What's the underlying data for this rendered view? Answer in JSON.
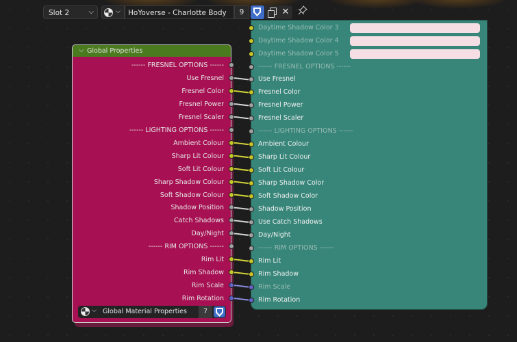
{
  "header": {
    "slot_label": "Slot 2",
    "material_name": "HoYoverse - Charlotte Body",
    "user_count": "9"
  },
  "group_node": {
    "title": "Global Properties",
    "sockets": [
      {
        "label": "------ FRESNEL OPTIONS ------",
        "type": "gray"
      },
      {
        "label": "Use Fresnel",
        "type": "gray"
      },
      {
        "label": "Fresnel Color",
        "type": "yellow"
      },
      {
        "label": "Fresnel Power",
        "type": "gray"
      },
      {
        "label": "Fresnel Scaler",
        "type": "gray"
      },
      {
        "label": "------ LIGHTING OPTIONS ------",
        "type": "gray"
      },
      {
        "label": "Ambient Colour",
        "type": "yellow"
      },
      {
        "label": "Sharp Lit Colour",
        "type": "yellow"
      },
      {
        "label": "Soft Lit Colour",
        "type": "yellow"
      },
      {
        "label": "Sharp Shadow Colour",
        "type": "yellow"
      },
      {
        "label": "Soft Shadow Colour",
        "type": "yellow"
      },
      {
        "label": "Shadow Position",
        "type": "gray"
      },
      {
        "label": "Catch Shadows",
        "type": "gray"
      },
      {
        "label": "Day/Night",
        "type": "gray"
      },
      {
        "label": "------ RIM OPTIONS ------",
        "type": "gray"
      },
      {
        "label": "Rim Lit",
        "type": "yellow"
      },
      {
        "label": "Rim Shadow",
        "type": "yellow"
      },
      {
        "label": "Rim Scale",
        "type": "blue"
      },
      {
        "label": "Rim Rotation",
        "type": "blue"
      }
    ],
    "group_name": "Global Material Properties",
    "group_users": "7"
  },
  "shader_node": {
    "color_inputs": [
      {
        "label": "Daytime Shadow Color 3",
        "type": "yellow",
        "color": "#f6dfe4"
      },
      {
        "label": "Daytime Shadow Color 4",
        "type": "yellow",
        "color": "#f6dfe4"
      },
      {
        "label": "Daytime Shadow Color 5",
        "type": "yellow",
        "color": "#f6dfe4"
      }
    ],
    "inputs": [
      {
        "label": "------ FRESNEL OPTIONS ------",
        "type": "gray",
        "dim": true
      },
      {
        "label": "Use Fresnel",
        "type": "gray"
      },
      {
        "label": "Fresnel Color",
        "type": "yellow"
      },
      {
        "label": "Fresnel Power",
        "type": "gray"
      },
      {
        "label": "Fresnel Scaler",
        "type": "gray"
      },
      {
        "label": "------ LIGHTING OPTIONS ------",
        "type": "gray",
        "dim": true
      },
      {
        "label": "Ambient Colour",
        "type": "yellow"
      },
      {
        "label": "Sharp Lit Colour",
        "type": "yellow"
      },
      {
        "label": "Soft Lit Colour",
        "type": "yellow"
      },
      {
        "label": "Sharp Shadow Color",
        "type": "yellow"
      },
      {
        "label": "Soft Shadow Color",
        "type": "yellow"
      },
      {
        "label": "Shadow Position",
        "type": "gray"
      },
      {
        "label": "Use Catch Shadows",
        "type": "gray"
      },
      {
        "label": "Day/Night",
        "type": "gray"
      },
      {
        "label": "------ RIM OPTIONS ------",
        "type": "gray",
        "dim": true
      },
      {
        "label": "Rim Lit",
        "type": "yellow"
      },
      {
        "label": "Rim Shadow",
        "type": "yellow"
      },
      {
        "label": "Rim Scale",
        "type": "blue",
        "dim": true
      },
      {
        "label": "Rim Rotation",
        "type": "blue"
      }
    ]
  },
  "colors": {
    "group_node_body": "#a71153",
    "group_node_header": "#4a7b1e",
    "shader_node_body": "#378679",
    "socket_gray": "#a1a1a1",
    "socket_yellow": "#c7c729",
    "socket_blue": "#6363c7",
    "accent": "#3f6dc8"
  },
  "icons": {
    "material": "material-sphere-icon",
    "fake_user": "shield-icon",
    "duplicate": "duplicate-icon",
    "unlink": "close-icon",
    "pin": "pin-icon"
  }
}
